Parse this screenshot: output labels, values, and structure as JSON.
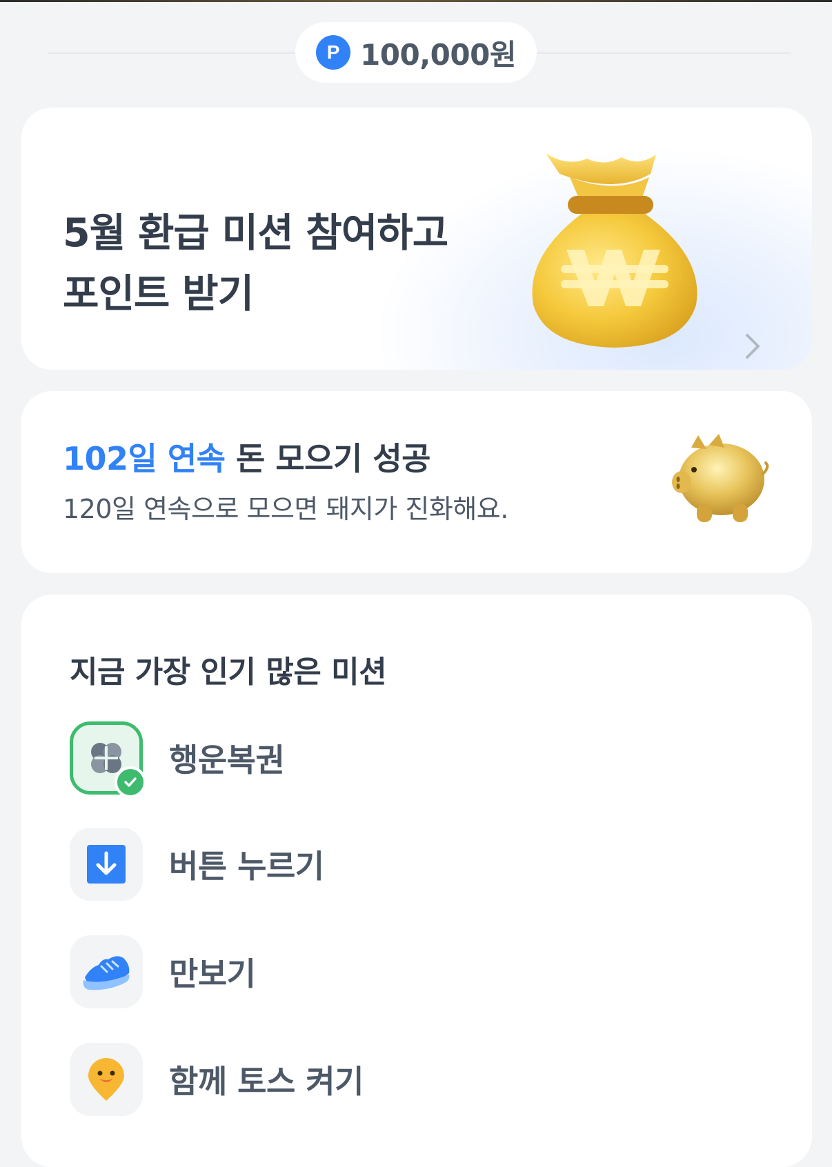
{
  "points": {
    "badge": "P",
    "amount": "100,000원"
  },
  "refund_card": {
    "title_line1": "5월 환급 미션 참여하고",
    "title_line2": "포인트 받기"
  },
  "streak_card": {
    "highlight": "102일 연속",
    "title_rest": " 돈 모으기 성공",
    "subtitle": "120일 연속으로 모으면 돼지가 진화해요."
  },
  "missions": {
    "heading": "지금 가장 인기 많은 미션",
    "items": [
      {
        "label": "행운복권",
        "icon": "clover-icon",
        "completed": true
      },
      {
        "label": "버튼 누르기",
        "icon": "download-arrow-icon",
        "completed": false
      },
      {
        "label": "만보기",
        "icon": "sneaker-icon",
        "completed": false
      },
      {
        "label": "함께 토스 켜기",
        "icon": "smiley-pin-icon",
        "completed": false
      }
    ]
  },
  "colors": {
    "accent": "#3182f6",
    "success": "#3ebb6e",
    "background": "#f2f4f6",
    "text": "#333d4b"
  }
}
